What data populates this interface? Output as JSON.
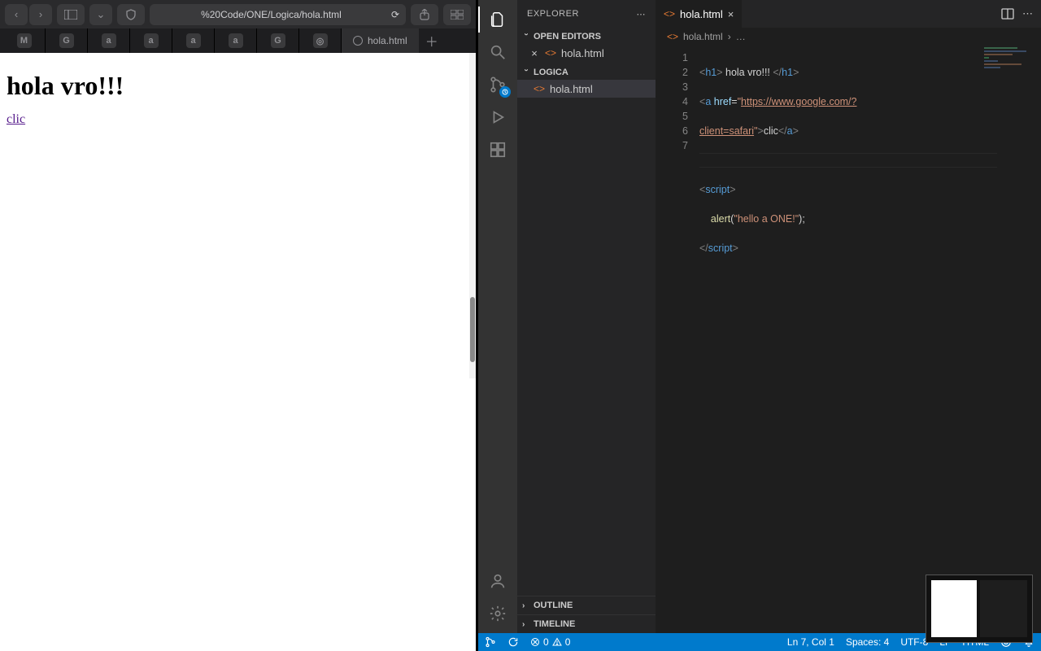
{
  "safari": {
    "url": "%20Code/ONE/Logica/hola.html",
    "tab_label": "hola.html",
    "favorites": [
      "M",
      "G",
      "a",
      "a",
      "a",
      "a",
      "G",
      "◎"
    ],
    "page": {
      "heading": "hola vro!!!",
      "link_text": "clic"
    }
  },
  "vscode": {
    "explorer_title": "EXPLORER",
    "sections": {
      "open_editors": "OPEN EDITORS",
      "workspace": "LOGICA",
      "outline": "OUTLINE",
      "timeline": "TIMELINE"
    },
    "open_editor_file": "hola.html",
    "workspace_file": "hola.html",
    "tab_file": "hola.html",
    "breadcrumb_file": "hola.html",
    "breadcrumb_sep": "›",
    "breadcrumb_more": "…",
    "code": {
      "l1_open": "<",
      "l1_tag": "h1",
      "l1_gt": ">",
      "l1_text": " hola vro!!! ",
      "l1_co": "</",
      "l1_cgt": ">",
      "l2_open": "<",
      "l2_tag": "a",
      "l2_sp": " ",
      "l2_attr": "href",
      "l2_eq": "=",
      "l2_q": "\"",
      "l2_url1": "https://www.google.com/?",
      "l2_url2": "client=safari",
      "l2_gt": ">",
      "l2_txt": "clic",
      "l2_co": "</",
      "l2_cgt": ">",
      "l4_open": "<",
      "l4_tag": "script",
      "l4_gt": ">",
      "l5_indent": "    ",
      "l5_fn": "alert",
      "l5_p": "(",
      "l5_q": "\"",
      "l5_str": "hello a ONE!",
      "l5_cp": ");",
      "l6_open": "</",
      "l6_tag": "script",
      "l6_gt": ">"
    },
    "line_numbers": [
      "1",
      "2",
      "",
      "3",
      "4",
      "5",
      "6",
      "7"
    ],
    "status": {
      "errors": "0",
      "warnings": "0",
      "cursor": "Ln 7, Col 1",
      "spaces": "Spaces: 4",
      "encoding": "UTF-8",
      "eol": "LF",
      "lang": "HTML"
    }
  }
}
